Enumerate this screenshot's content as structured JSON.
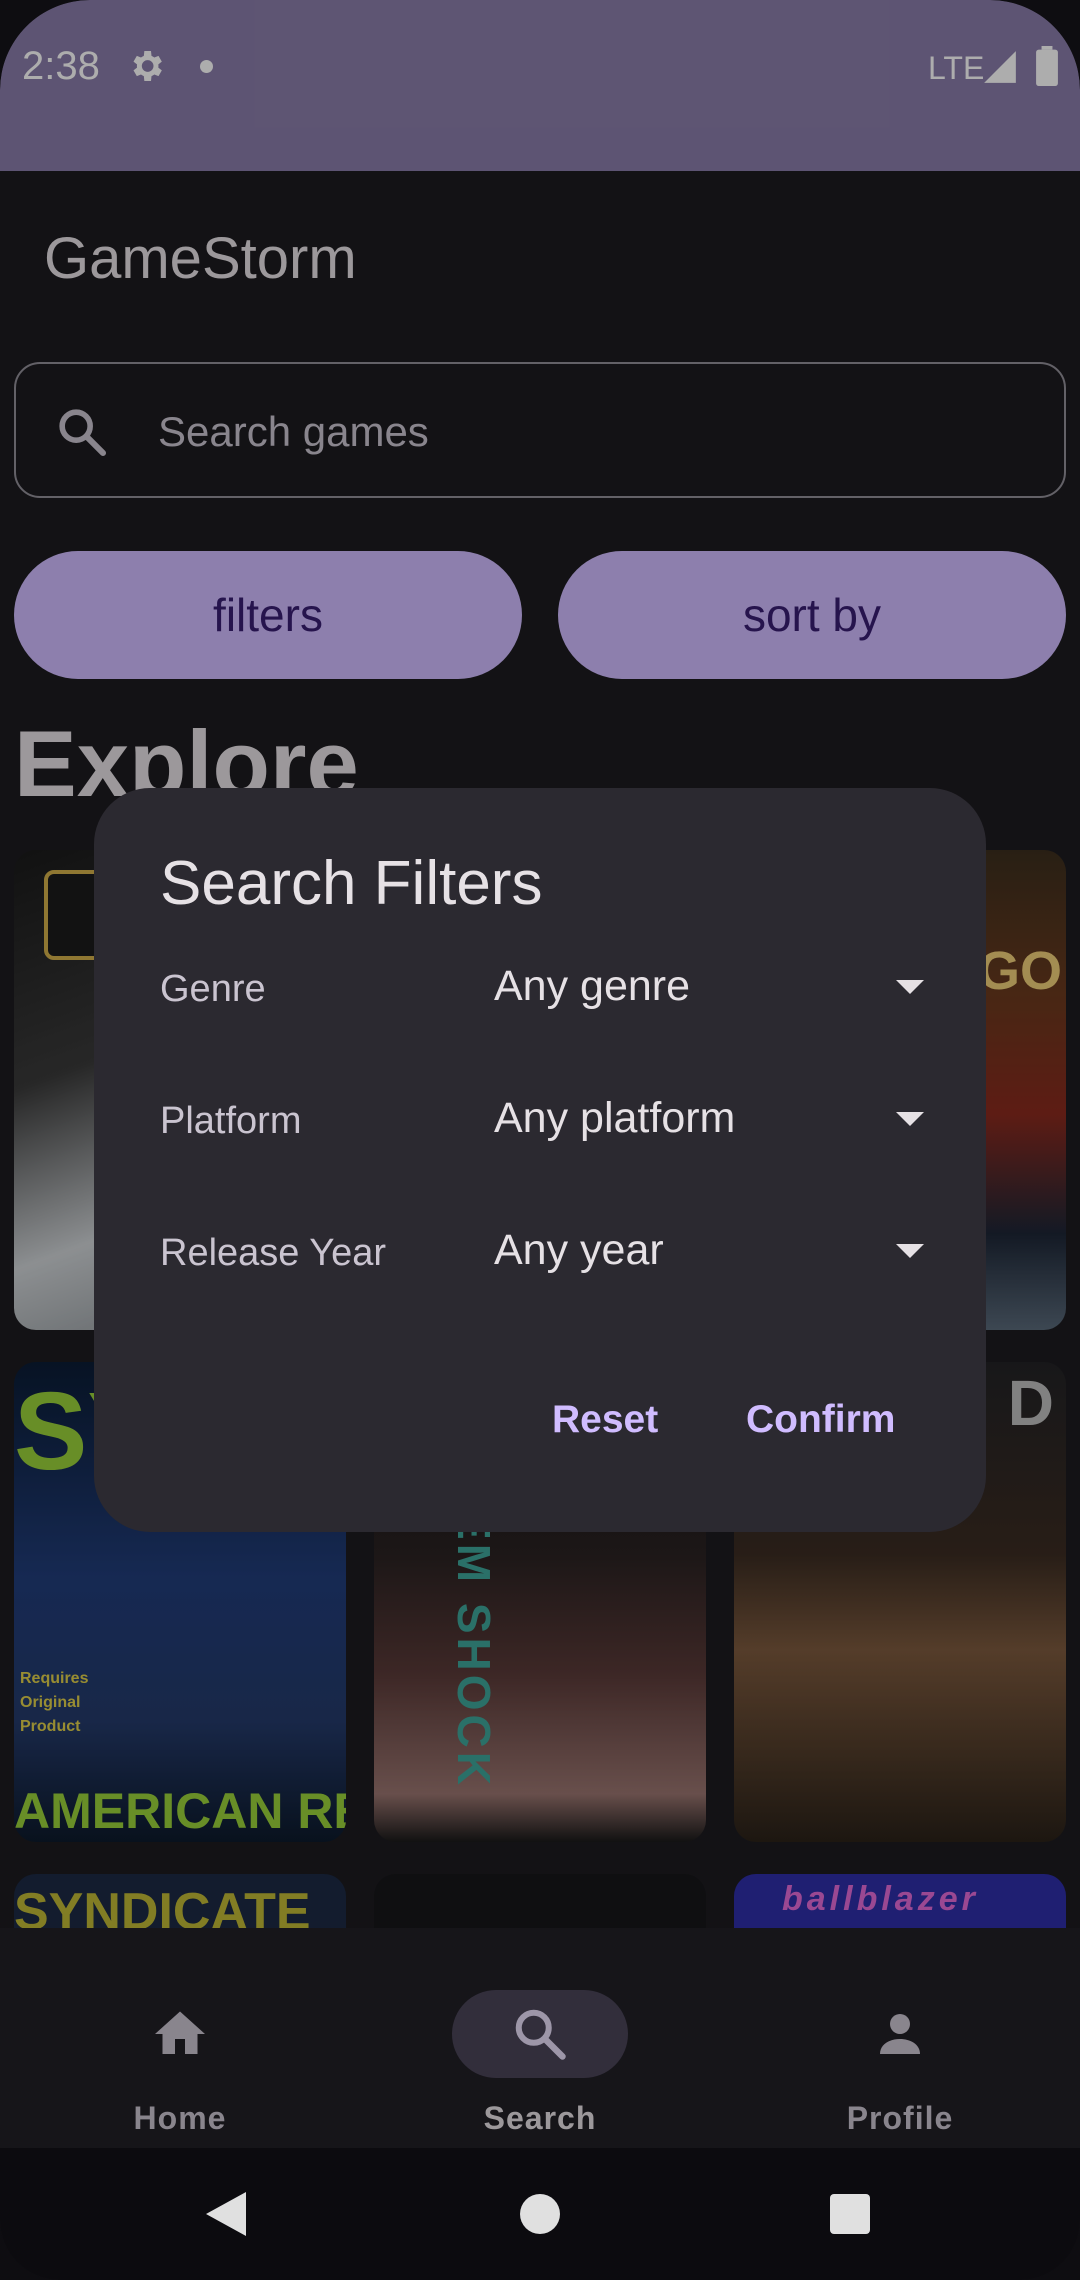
{
  "status_bar": {
    "time": "2:38",
    "network": "LTE",
    "icons": [
      "gear-icon",
      "notification-dot-icon",
      "signal-icon",
      "battery-icon"
    ]
  },
  "app": {
    "title": "GameStorm"
  },
  "search": {
    "placeholder": "Search games",
    "icon": "search-icon"
  },
  "actions": {
    "filters_label": "filters",
    "sort_label": "sort by"
  },
  "section": {
    "title": "Explore"
  },
  "games": {
    "tile_texts": [
      {
        "text": "SY"
      },
      {
        "text": "Requires Original Product"
      },
      {
        "text": "AMERICAN REVOLT"
      },
      {
        "text": "EM SHOCK"
      },
      {
        "text": "GO"
      },
      {
        "text": "D"
      },
      {
        "text": "SYNDICATE"
      },
      {
        "text": "ballblazer"
      }
    ]
  },
  "dialog": {
    "title": "Search Filters",
    "filters": [
      {
        "label": "Genre",
        "value": "Any genre"
      },
      {
        "label": "Platform",
        "value": "Any platform"
      },
      {
        "label": "Release Year",
        "value": "Any year"
      }
    ],
    "reset_label": "Reset",
    "confirm_label": "Confirm"
  },
  "nav": {
    "items": [
      {
        "label": "Home",
        "icon": "home-icon",
        "selected": false
      },
      {
        "label": "Search",
        "icon": "search-icon",
        "selected": true
      },
      {
        "label": "Profile",
        "icon": "person-icon",
        "selected": false
      }
    ]
  },
  "colors": {
    "status_bar": "#8a7daa",
    "accent": "#d0bcff",
    "on_accent": "#381e72",
    "surface": "#1c1b1f",
    "dialog": "#2b2930"
  }
}
